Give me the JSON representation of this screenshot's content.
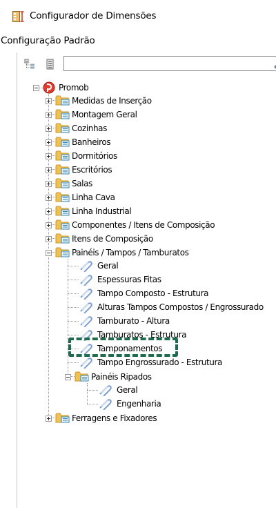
{
  "window": {
    "title": "Configurador de Dimensões"
  },
  "config_label": "Configuração Padrão",
  "search": {
    "value": ""
  },
  "tree": {
    "root": {
      "label": "Promob"
    },
    "categories": [
      {
        "label": "Medidas de Inserção",
        "expanded": false
      },
      {
        "label": "Montagem Geral",
        "expanded": false
      },
      {
        "label": "Cozinhas",
        "expanded": false
      },
      {
        "label": "Banheiros",
        "expanded": false
      },
      {
        "label": "Dormitórios",
        "expanded": false
      },
      {
        "label": "Escritórios",
        "expanded": false
      },
      {
        "label": "Salas",
        "expanded": false
      },
      {
        "label": "Linha Cava",
        "expanded": false
      },
      {
        "label": "Linha Industrial",
        "expanded": false
      },
      {
        "label": "Componentes / Itens de Composição",
        "expanded": false
      },
      {
        "label": "Itens de Composição",
        "expanded": false
      },
      {
        "label": "Painéis / Tampos / Tamburatos",
        "expanded": true
      },
      {
        "label": "Ferragens e Fixadores",
        "expanded": false
      }
    ],
    "paineis_children": [
      "Geral",
      "Espessuras Fitas",
      "Tampo Composto - Estrutura",
      "Alturas Tampos Compostos / Engrossurado",
      "Tamburato - Altura",
      "Tamburatos - Estrutura",
      "Tamponamentos",
      "Tampo Engrossurado - Estrutura"
    ],
    "paineis_ripados": {
      "label": "Painéis Ripados",
      "children": [
        "Geral",
        "Engenharia"
      ]
    }
  },
  "highlighted_item": "Tamponamentos",
  "colors": {
    "highlight": "#1f6b4e",
    "folder": "#f2c14e",
    "leaf": "#7b9fd0"
  }
}
